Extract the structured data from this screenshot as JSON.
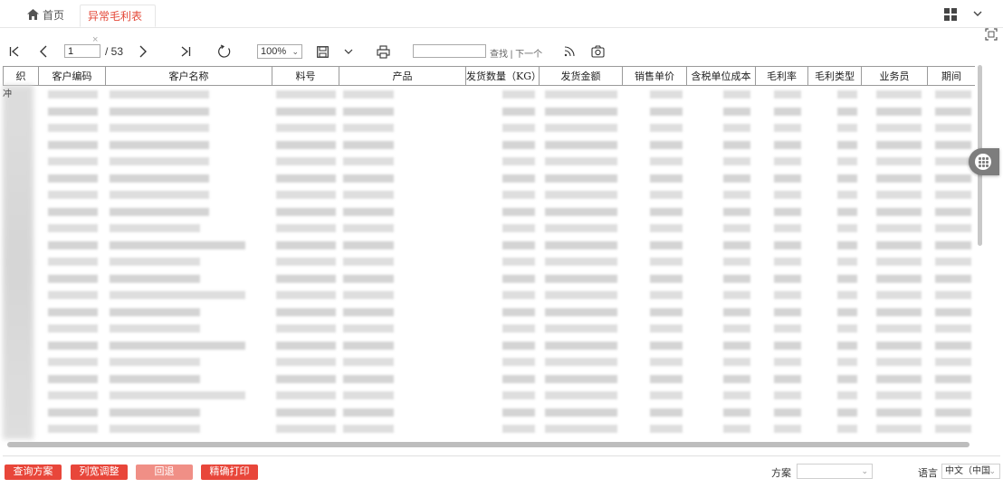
{
  "tabs": {
    "home_label": "首页",
    "active_label": "异常毛利表",
    "close_glyph": "×"
  },
  "toolbar": {
    "current_page": "1",
    "total_pages": "/ 53",
    "zoom": "100%",
    "find_label": "查找 | 下一个"
  },
  "table": {
    "columns": [
      "组织",
      "客户编码",
      "客户名称",
      "料号",
      "产品",
      "发货数量（KG）",
      "发货金额",
      "销售单价",
      "含税单位成本",
      "毛利率",
      "毛利类型",
      "业务员",
      "期间"
    ],
    "column_header_visible_text": [
      "织",
      "客户编码",
      "客户名称",
      "料号",
      "产品",
      "发货数量（KG）",
      "发货金额",
      "销售单价",
      "含税单位成本",
      "毛利率",
      "毛利类型",
      "业务员",
      "期间"
    ],
    "first_cell_fragment": "冲",
    "row_count_visible": 21
  },
  "footer": {
    "buttons": [
      "查询方案",
      "列宽调整",
      "回退",
      "精确打印"
    ],
    "scheme_label": "方案",
    "scheme_value": "",
    "language_label": "语言",
    "language_value": "中文（中国"
  },
  "colors": {
    "accent": "#e8463a",
    "accent_disabled": "#f08f86",
    "active_tab_text": "#e44a3a"
  }
}
